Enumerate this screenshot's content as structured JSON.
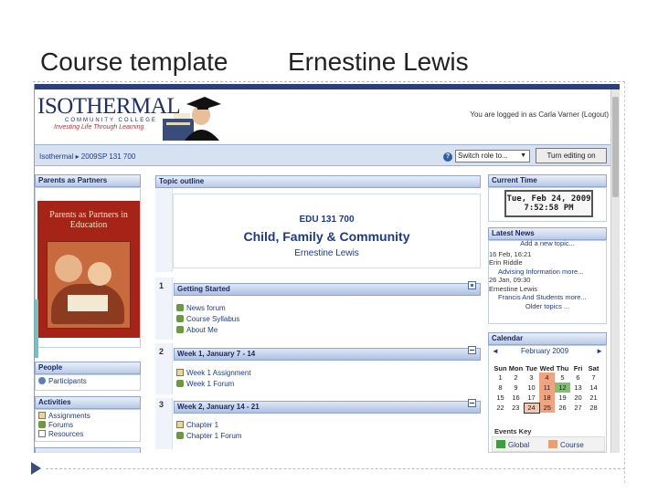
{
  "slide": {
    "title": "Course template",
    "author": "Ernestine Lewis"
  },
  "header": {
    "logo_main": "ISOTHERMAL",
    "logo_sub": "COMMUNITY COLLEGE",
    "logo_tagline": "Investing Life Through Learning",
    "login_status": "You are logged in as Carla Varner (Logout)"
  },
  "navbar": {
    "breadcrumb": "Isothermal ▸ 2009SP 131 700",
    "role_select": "Switch role to...",
    "edit_button": "Turn editing on"
  },
  "left": {
    "parents_header": "Parents as Partners",
    "book_title": "Parents as Partners in Education",
    "people_header": "People",
    "participants": "Participants",
    "activities_header": "Activities",
    "activities": [
      "Assignments",
      "Forums",
      "Resources"
    ]
  },
  "center": {
    "outline_header": "Topic outline",
    "course_code": "EDU 131 700",
    "course_name": "Child, Family & Community",
    "instructor": "Ernestine Lewis",
    "sections": [
      {
        "num": "1",
        "title": "Getting Started",
        "links": [
          "News forum",
          "Course Syllabus",
          "About Me"
        ]
      },
      {
        "num": "2",
        "title": "Week 1, January 7 - 14",
        "links": [
          "Week 1 Assignment",
          "Week 1 Forum"
        ]
      },
      {
        "num": "3",
        "title": "Week 2, January 14 - 21",
        "links": [
          "Chapter 1",
          "Chapter 1 Forum"
        ]
      }
    ]
  },
  "right": {
    "time_header": "Current Time",
    "time_date": "Tue, Feb 24, 2009",
    "time_clock": "7:52:58 PM",
    "news_header": "Latest News",
    "news_add": "Add a new topic...",
    "news_items": [
      {
        "date": "16 Feb, 16:21",
        "author": "Erin Riddle",
        "text": "Advising Information more..."
      },
      {
        "date": "26 Jan, 09:30",
        "author": "Ernestine Lewis",
        "text": "Francis And Students more..."
      }
    ],
    "news_older": "Older topics ...",
    "calendar_header": "Calendar",
    "calendar_month": "February 2009",
    "calendar_prev": "◄",
    "calendar_next": "►",
    "weekdays": [
      "Sun",
      "Mon",
      "Tue",
      "Wed",
      "Thu",
      "Fri",
      "Sat"
    ],
    "weeks": [
      [
        "1",
        "2",
        "3",
        "4",
        "5",
        "6",
        "7"
      ],
      [
        "8",
        "9",
        "10",
        "11",
        "12",
        "13",
        "14"
      ],
      [
        "15",
        "16",
        "17",
        "18",
        "19",
        "20",
        "21"
      ],
      [
        "22",
        "23",
        "24",
        "25",
        "26",
        "27",
        "28"
      ]
    ],
    "events_key": "Events Key",
    "key_global": "Global",
    "key_course": "Course"
  },
  "colors": {
    "nav_blue": "#1e3c8c",
    "header_band": "#2a3f7c",
    "highlight": "#f1a37f",
    "today": "#7fc26e"
  }
}
